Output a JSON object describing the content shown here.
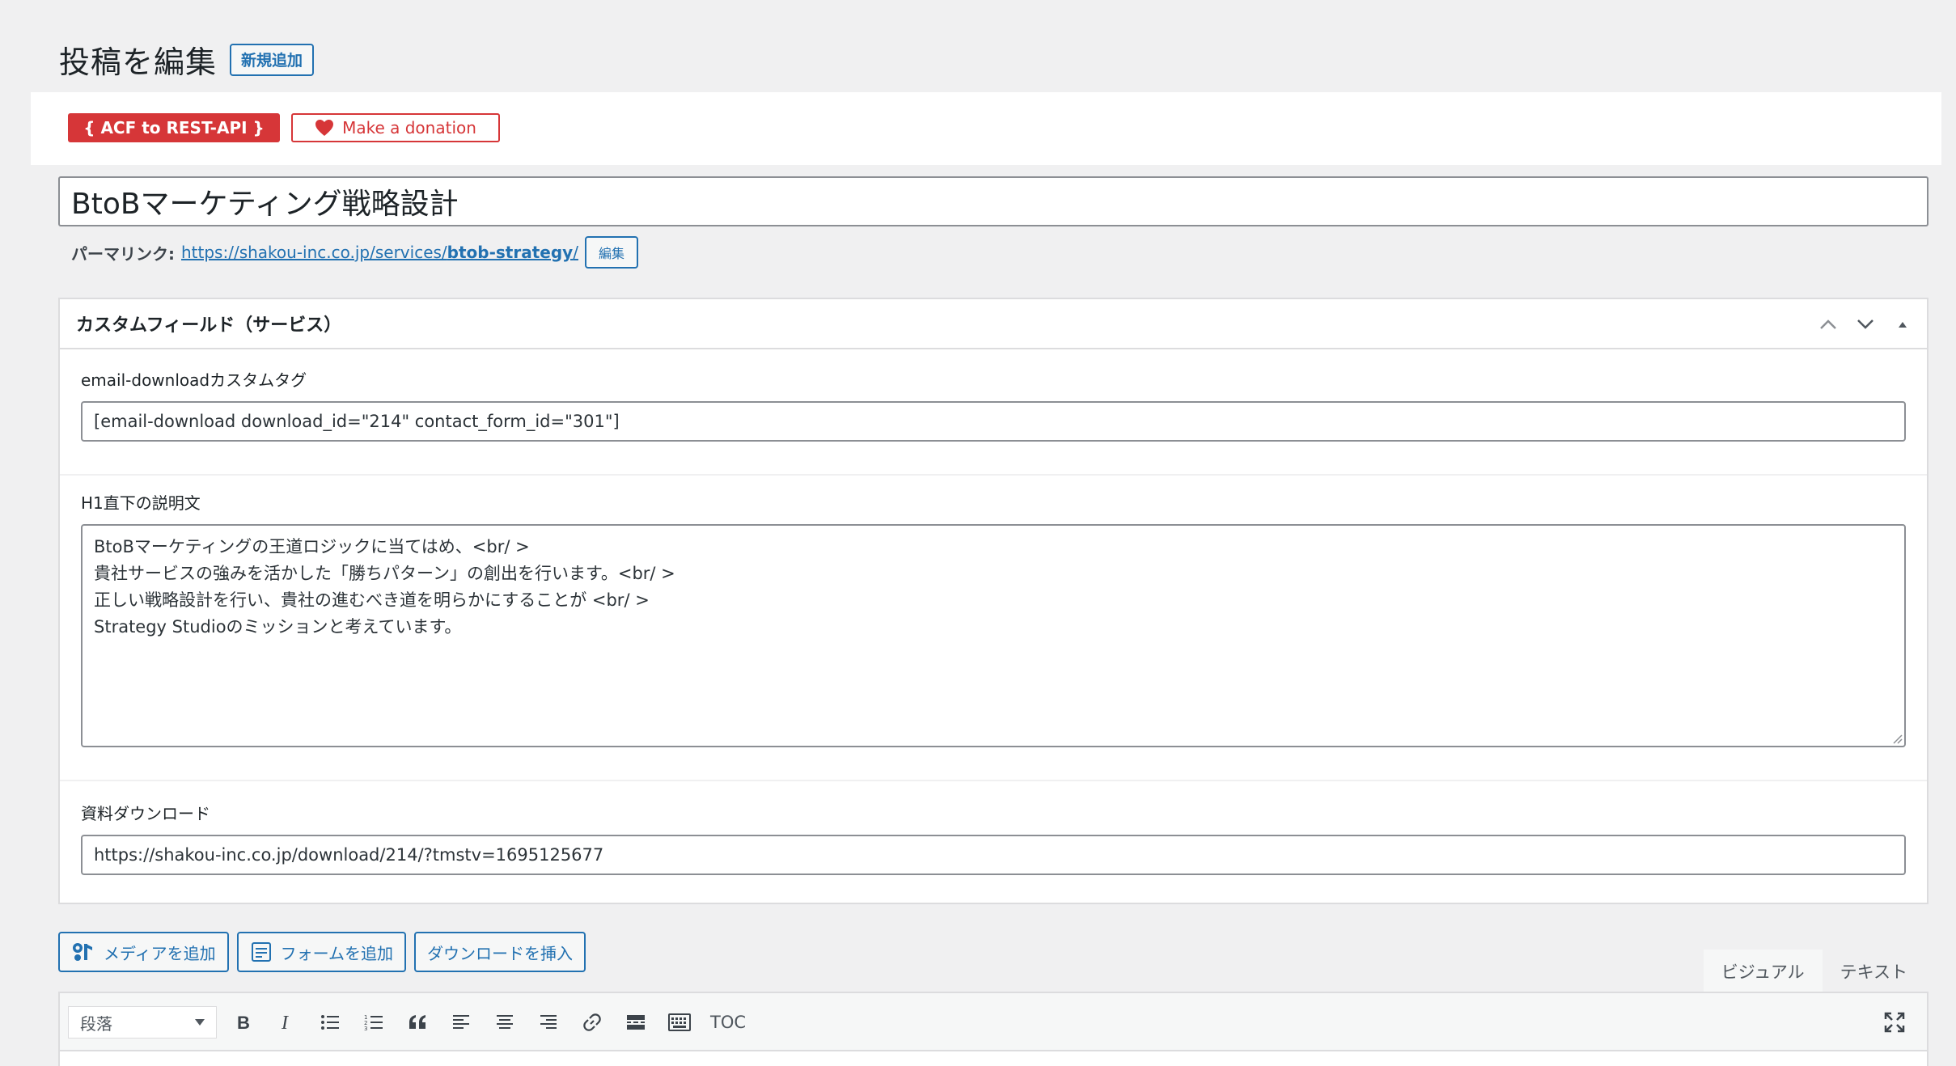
{
  "header": {
    "title": "投稿を編集",
    "add_new": "新規追加"
  },
  "plugins": {
    "acf_badge": "{ ACF to REST-API }",
    "donation": "Make a donation"
  },
  "post": {
    "title": "BtoBマーケティング戦略設計",
    "permalink_label": "パーマリンク:",
    "permalink_base": "https://shakou-inc.co.jp/services/",
    "permalink_slug": "btob-strategy",
    "permalink_trailing": "/",
    "permalink_edit": "編集"
  },
  "custom_fields": {
    "title": "カスタムフィールド（サービス）",
    "fields": [
      {
        "label": "email-downloadカスタムタグ",
        "value": "[email-download download_id=\"214\" contact_form_id=\"301\"]"
      },
      {
        "label": "H1直下の説明文",
        "lines": [
          "BtoBマーケティングの王道ロジックに当てはめ、<br/ >",
          "貴社サービスの強みを活かした「勝ちパターン」の創出を行います。<br/ >",
          "正しい戦略設計を行い、貴社の進むべき道を明らかにすることが <br/ >",
          "Strategy Studioのミッションと考えています。"
        ]
      },
      {
        "label": "資料ダウンロード",
        "value": "https://shakou-inc.co.jp/download/214/?tmstv=1695125677"
      }
    ]
  },
  "editor": {
    "media_buttons": [
      "メディアを追加",
      "フォームを追加",
      "ダウンロードを挿入"
    ],
    "tabs": [
      "ビジュアル",
      "テキスト"
    ],
    "format_select": "段落",
    "toc_label": "TOC"
  },
  "colors": {
    "accent": "#2271b1",
    "danger": "#d63638",
    "background": "#f0f0f1"
  }
}
